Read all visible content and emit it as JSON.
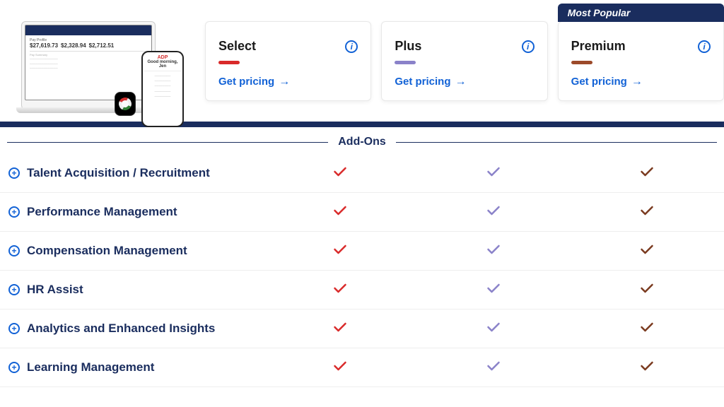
{
  "badge": {
    "most_popular": "Most Popular"
  },
  "plans": {
    "select": {
      "title": "Select",
      "cta": "Get pricing"
    },
    "plus": {
      "title": "Plus",
      "cta": "Get pricing"
    },
    "premium": {
      "title": "Premium",
      "cta": "Get pricing"
    }
  },
  "section": {
    "addons_title": "Add-Ons"
  },
  "addons": [
    {
      "label": "Talent Acquisition / Recruitment",
      "select": true,
      "plus": true,
      "premium": true
    },
    {
      "label": "Performance Management",
      "select": true,
      "plus": true,
      "premium": true
    },
    {
      "label": "Compensation Management",
      "select": true,
      "plus": true,
      "premium": true
    },
    {
      "label": "HR Assist",
      "select": true,
      "plus": true,
      "premium": true
    },
    {
      "label": "Analytics and Enhanced Insights",
      "select": true,
      "plus": true,
      "premium": true
    },
    {
      "label": "Learning Management",
      "select": true,
      "plus": true,
      "premium": true
    }
  ],
  "device_mock": {
    "numbers": [
      "$27,619.73",
      "$2,328.94",
      "$2,712.51"
    ],
    "phone_greeting": "Good morning, Jen"
  },
  "chart_data": {
    "type": "table",
    "title": "Add-Ons availability by plan",
    "columns": [
      "Add-On",
      "Select",
      "Plus",
      "Premium"
    ],
    "rows": [
      [
        "Talent Acquisition / Recruitment",
        "✓",
        "✓",
        "✓"
      ],
      [
        "Performance Management",
        "✓",
        "✓",
        "✓"
      ],
      [
        "Compensation Management",
        "✓",
        "✓",
        "✓"
      ],
      [
        "HR Assist",
        "✓",
        "✓",
        "✓"
      ],
      [
        "Analytics and Enhanced Insights",
        "✓",
        "✓",
        "✓"
      ],
      [
        "Learning Management",
        "✓",
        "✓",
        "✓"
      ]
    ]
  }
}
